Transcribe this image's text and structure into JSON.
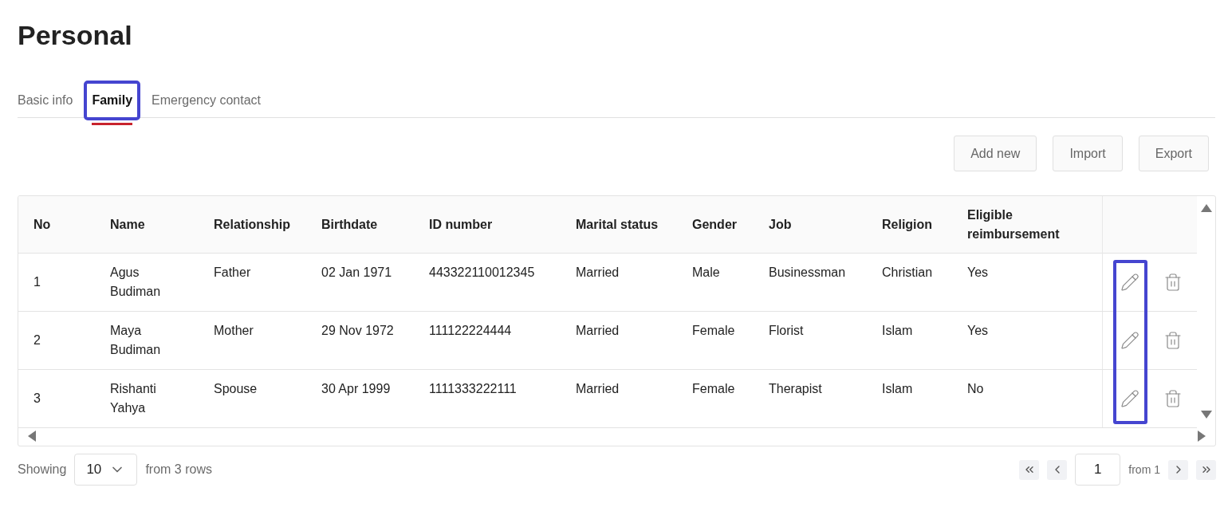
{
  "title": "Personal",
  "tabs": [
    {
      "label": "Basic info",
      "selected": false,
      "highlighted": false
    },
    {
      "label": "Family",
      "selected": true,
      "highlighted": true
    },
    {
      "label": "Emergency contact",
      "selected": false,
      "highlighted": false
    }
  ],
  "actions": [
    "Add new",
    "Import",
    "Export"
  ],
  "table": {
    "columns": [
      "No",
      "Name",
      "Relationship",
      "Birthdate",
      "ID number",
      "Marital status",
      "Gender",
      "Job",
      "Religion",
      "Eligible reimbursement"
    ],
    "edit_column_highlighted": true,
    "rows": [
      [
        "1",
        "Agus Budiman",
        "Father",
        "02 Jan 1971",
        "443322110012345",
        "Married",
        "Male",
        "Businessman",
        "Christian",
        "Yes"
      ],
      [
        "2",
        "Maya Budiman",
        "Mother",
        "29 Nov 1972",
        "111122224444",
        "Married",
        "Female",
        "Florist",
        "Islam",
        "Yes"
      ],
      [
        "3",
        "Rishanti Yahya",
        "Spouse",
        "30 Apr 1999",
        "1111333222111",
        "Married",
        "Female",
        "Therapist",
        "Islam",
        "No"
      ]
    ]
  },
  "footer": {
    "showing_label": "Showing",
    "page_size": "10",
    "rows_label": "from 3 rows",
    "page": "1",
    "pages_label": "from 1"
  }
}
